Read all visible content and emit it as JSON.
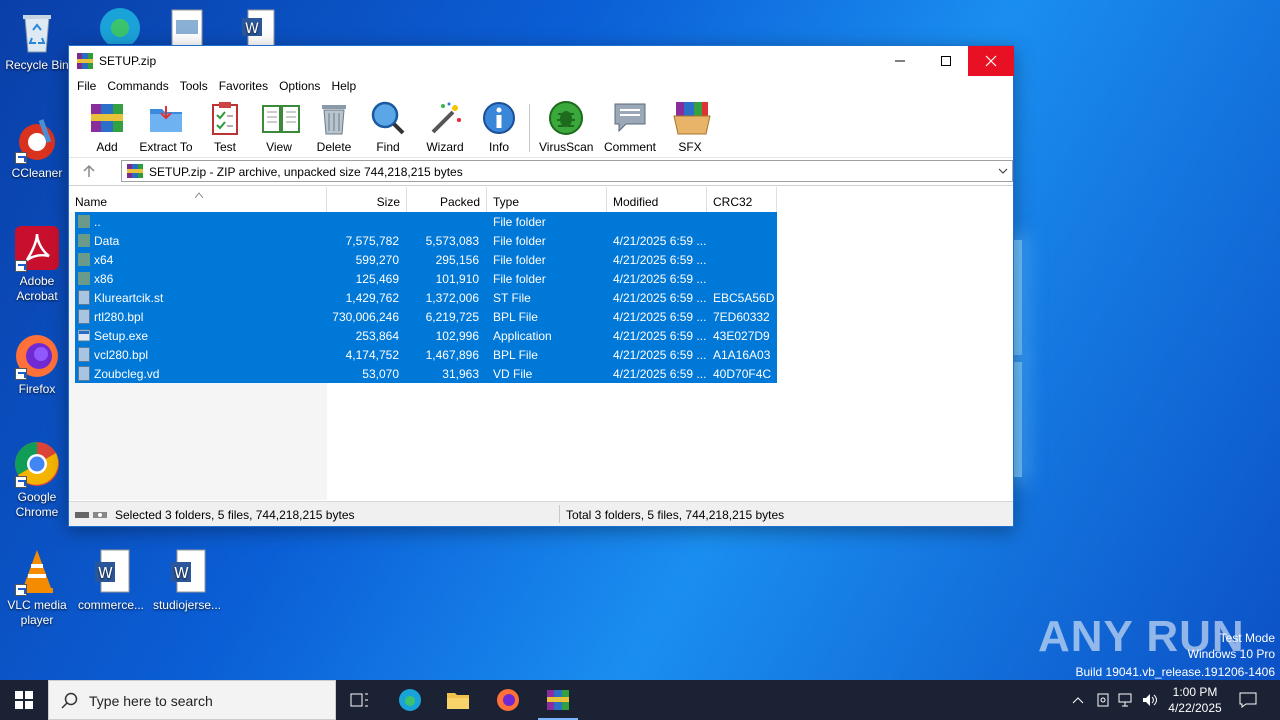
{
  "desktop": {
    "icons": [
      {
        "label": "Recycle Bin"
      },
      {
        "label": "CCleaner"
      },
      {
        "label": "Adobe Acrobat"
      },
      {
        "label": "Firefox"
      },
      {
        "label": "Google Chrome"
      },
      {
        "label": "VLC media player"
      },
      {
        "label": "commerce..."
      },
      {
        "label": "studiojerse..."
      }
    ],
    "watermark": {
      "brand": "ANY RUN",
      "mode": "Test Mode",
      "os": "Windows 10 Pro",
      "build": "Build 19041.vb_release.191206-1406"
    }
  },
  "window": {
    "title": "SETUP.zip",
    "menu": [
      "File",
      "Commands",
      "Tools",
      "Favorites",
      "Options",
      "Help"
    ],
    "toolbar": [
      "Add",
      "Extract To",
      "Test",
      "View",
      "Delete",
      "Find",
      "Wizard",
      "Info",
      "VirusScan",
      "Comment",
      "SFX"
    ],
    "address": "SETUP.zip - ZIP archive, unpacked size 744,218,215 bytes",
    "columns": [
      "Name",
      "Size",
      "Packed",
      "Type",
      "Modified",
      "CRC32"
    ],
    "rows": [
      {
        "name": "..",
        "size": "",
        "packed": "",
        "type": "File folder",
        "modified": "",
        "crc": "",
        "kind": "folder"
      },
      {
        "name": "Data",
        "size": "7,575,782",
        "packed": "5,573,083",
        "type": "File folder",
        "modified": "4/21/2025 6:59 ...",
        "crc": "",
        "kind": "folder"
      },
      {
        "name": "x64",
        "size": "599,270",
        "packed": "295,156",
        "type": "File folder",
        "modified": "4/21/2025 6:59 ...",
        "crc": "",
        "kind": "folder"
      },
      {
        "name": "x86",
        "size": "125,469",
        "packed": "101,910",
        "type": "File folder",
        "modified": "4/21/2025 6:59 ...",
        "crc": "",
        "kind": "folder"
      },
      {
        "name": "Klureartcik.st",
        "size": "1,429,762",
        "packed": "1,372,006",
        "type": "ST File",
        "modified": "4/21/2025 6:59 ...",
        "crc": "EBC5A56D",
        "kind": "file"
      },
      {
        "name": "rtl280.bpl",
        "size": "730,006,246",
        "packed": "6,219,725",
        "type": "BPL File",
        "modified": "4/21/2025 6:59 ...",
        "crc": "7ED60332",
        "kind": "file"
      },
      {
        "name": "Setup.exe",
        "size": "253,864",
        "packed": "102,996",
        "type": "Application",
        "modified": "4/21/2025 6:59 ...",
        "crc": "43E027D9",
        "kind": "exe"
      },
      {
        "name": "vcl280.bpl",
        "size": "4,174,752",
        "packed": "1,467,896",
        "type": "BPL File",
        "modified": "4/21/2025 6:59 ...",
        "crc": "A1A16A03",
        "kind": "file"
      },
      {
        "name": "Zoubcleg.vd",
        "size": "53,070",
        "packed": "31,963",
        "type": "VD File",
        "modified": "4/21/2025 6:59 ...",
        "crc": "40D70F4C",
        "kind": "file"
      }
    ],
    "status_selected": "Selected 3 folders, 5 files, 744,218,215 bytes",
    "status_total": "Total 3 folders, 5 files, 744,218,215 bytes"
  },
  "taskbar": {
    "search_placeholder": "Type here to search",
    "time": "1:00 PM",
    "date": "4/22/2025"
  },
  "colors": {
    "selection": "#0078d7",
    "close": "#e81123",
    "taskbar": "#1b2233"
  }
}
